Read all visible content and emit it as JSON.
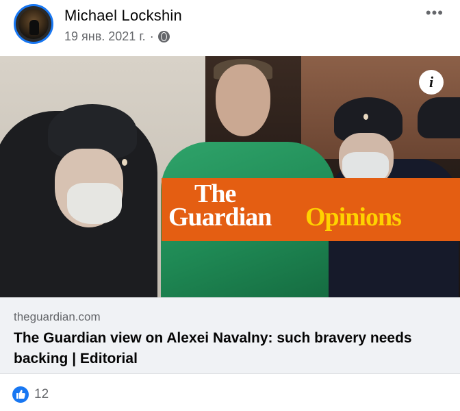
{
  "post": {
    "author": "Michael Lockshin",
    "date": "19 янв. 2021 г.",
    "separator": "·",
    "more_label": "•••"
  },
  "image": {
    "info_label": "i",
    "banner_the": "The",
    "banner_guardian": "Guardian",
    "banner_opinions": "Opinions"
  },
  "link": {
    "domain": "theguardian.com",
    "title": "The Guardian view on Alexei Navalny: such bravery needs backing | Editorial"
  },
  "reactions": {
    "count": "12"
  },
  "colors": {
    "accent": "#1877f2",
    "banner_orange": "#e45e12",
    "banner_yellow": "#ffd200"
  }
}
